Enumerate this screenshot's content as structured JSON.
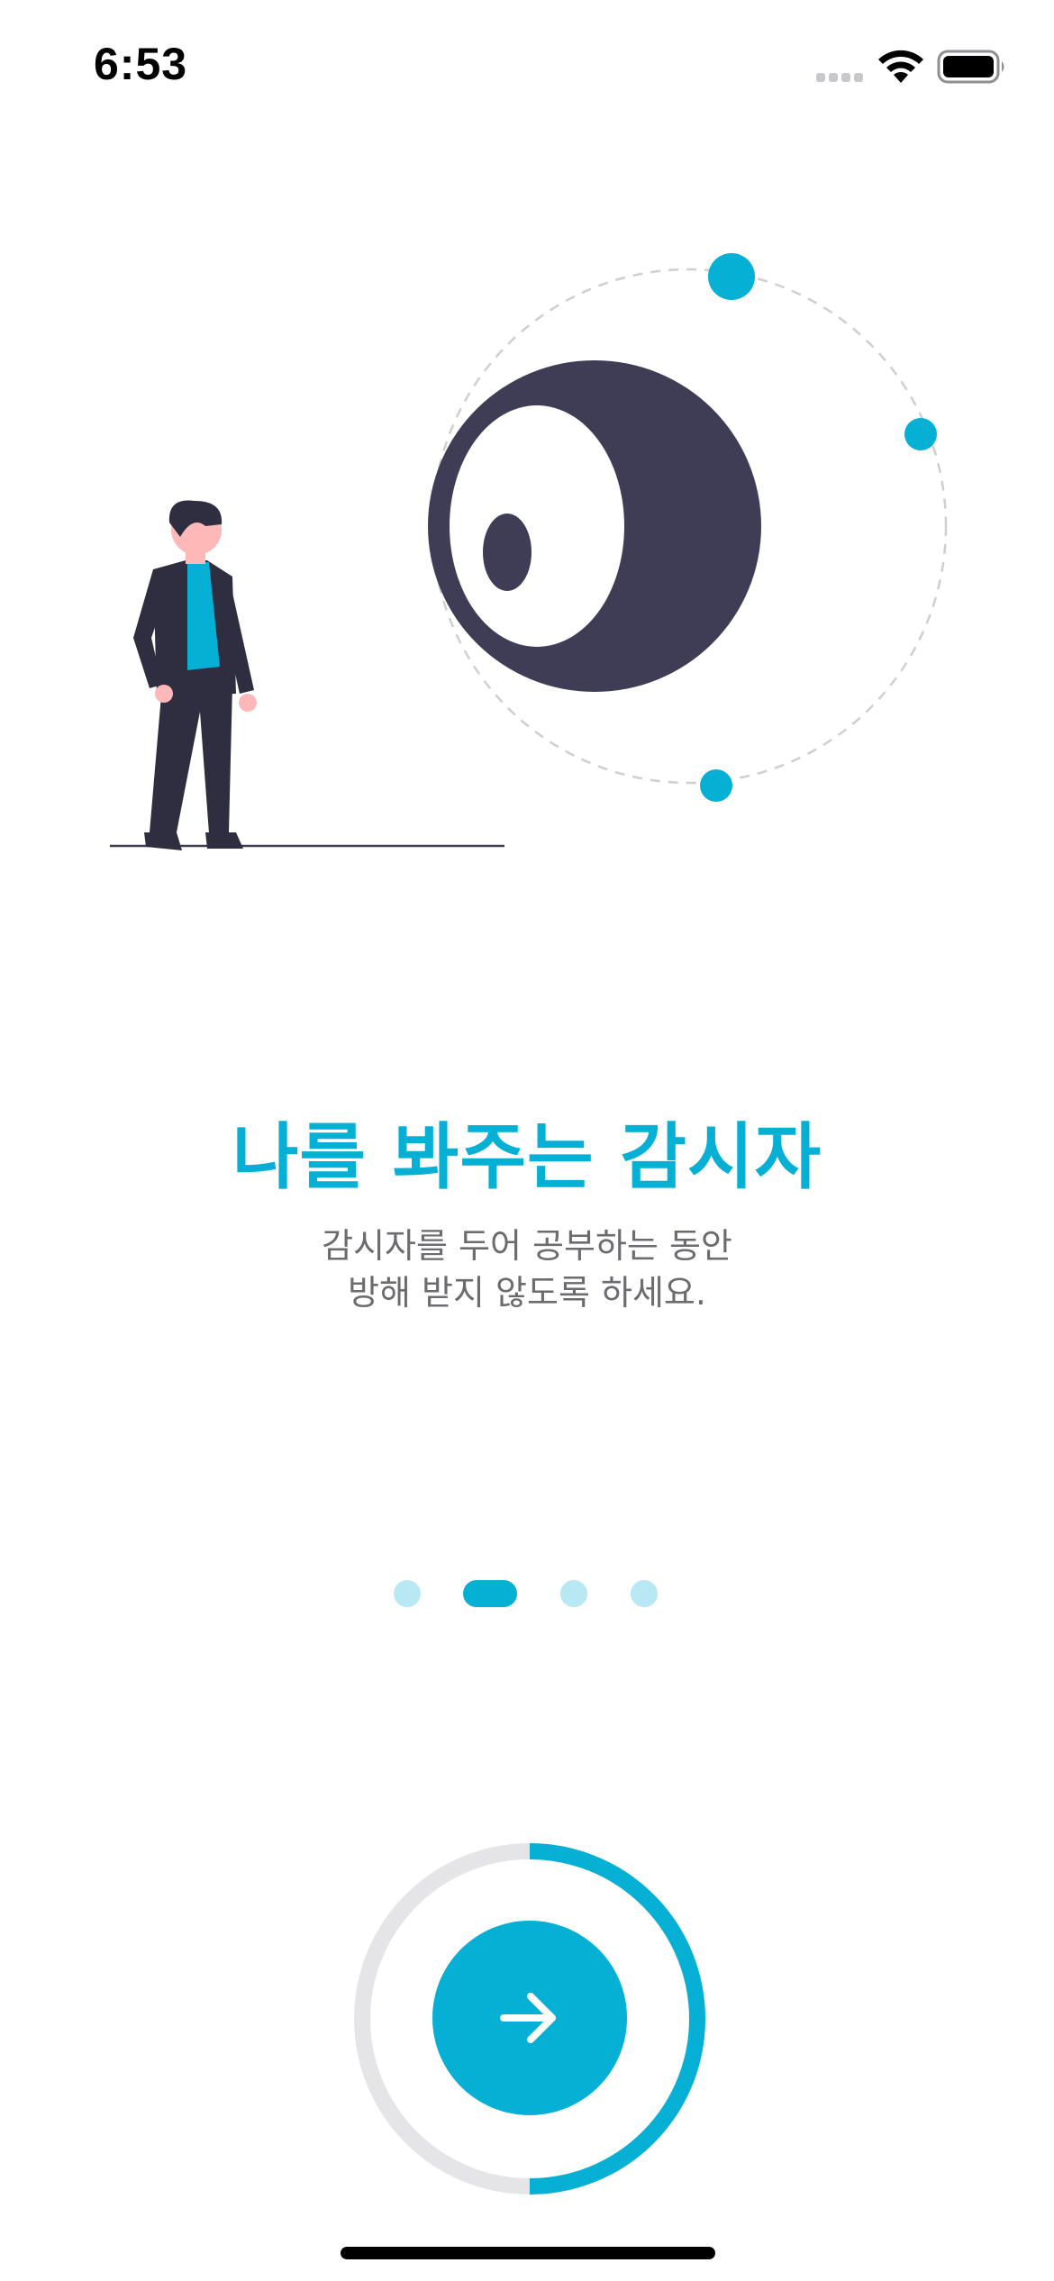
{
  "status_bar": {
    "time": "6:53",
    "icons": [
      "signal-icon",
      "wifi-icon",
      "battery-icon"
    ]
  },
  "illustration": {
    "name": "man-watching-eye-illustration",
    "colors": {
      "accent": "#06b0d4",
      "dark": "#3f3d56",
      "skin": "#ffb8b8",
      "ground": "#3f3d56",
      "orbit": "#cccccc"
    }
  },
  "onboarding": {
    "title": "나를 봐주는 감시자",
    "description_line1": "감시자를 두어 공부하는 동안",
    "description_line2": "방해 받지 않도록 하세요."
  },
  "pager": {
    "total_pages": 4,
    "current_page": 2
  },
  "next_button": {
    "icon": "arrow-right-icon",
    "progress": 0.5
  },
  "colors": {
    "accent": "#06b0d4",
    "dot_inactive": "#b7e8f3",
    "ring_track": "#e5e5e7",
    "description": "#6b6b70"
  }
}
